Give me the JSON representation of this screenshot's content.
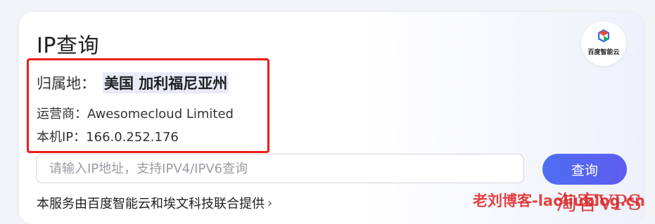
{
  "title": "IP查询",
  "logo": {
    "text": "百度智能云",
    "icon": "baidu-cloud-logo-icon"
  },
  "result": {
    "location_label": "归属地：",
    "location_value": "美国 加利福尼亚州",
    "isp_label": "运营商：",
    "isp_value": "Awesomecloud Limited",
    "ip_label": "本机IP：",
    "ip_value": "166.0.252.176"
  },
  "search": {
    "placeholder": "请输入IP地址，支持IPV4/IPV6查询",
    "value": ""
  },
  "button": {
    "label": "查询"
  },
  "footer": {
    "text": "本服务由百度智能云和埃文科技联合提供",
    "chevron": "›"
  },
  "watermark": {
    "site": "老刘博客-laoliublog.cn",
    "brand": "淘客VPS"
  },
  "colors": {
    "accent": "#4e6ef2",
    "highlight_box": "#ee1b1b"
  }
}
